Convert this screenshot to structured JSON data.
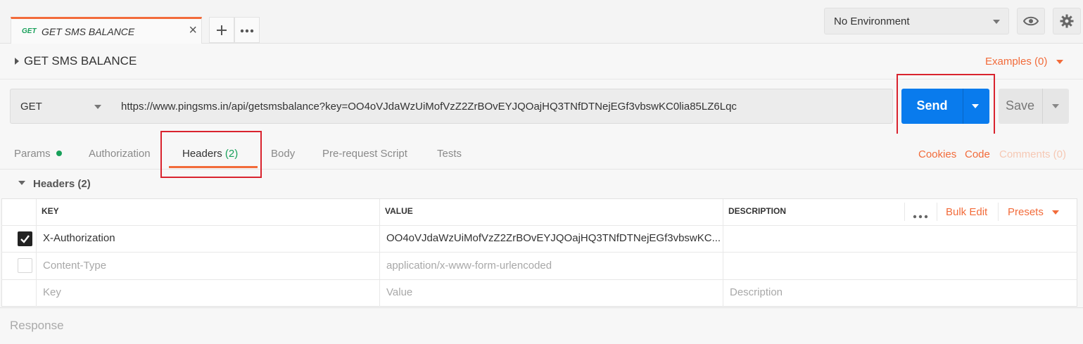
{
  "tab": {
    "method": "GET",
    "name": "GET SMS BALANCE"
  },
  "environment": {
    "selected": "No Environment"
  },
  "request": {
    "title": "GET SMS BALANCE",
    "examples": "Examples (0)",
    "method": "GET",
    "url": "https://www.pingsms.in/api/getsmsbalance?key=OO4oVJdaWzUiMofVzZ2ZrBOvEYJQOajHQ3TNfDTNejEGf3vbswKC0lia85LZ6Lqc",
    "send_label": "Send",
    "save_label": "Save"
  },
  "subtabs": {
    "params": "Params",
    "authorization": "Authorization",
    "headers": "Headers",
    "headers_count": "(2)",
    "body": "Body",
    "prerequest": "Pre-request Script",
    "tests": "Tests"
  },
  "links": {
    "cookies": "Cookies",
    "code": "Code",
    "comments": "Comments (0)"
  },
  "headers_section": {
    "title": "Headers",
    "count": "(2)",
    "columns": {
      "key": "KEY",
      "value": "VALUE",
      "description": "DESCRIPTION"
    },
    "bulk_edit": "Bulk Edit",
    "presets": "Presets",
    "rows": [
      {
        "checked": true,
        "key": "X-Authorization",
        "value": "OO4oVJdaWzUiMofVzZ2ZrBOvEYJQOajHQ3TNfDTNejEGf3vbswKC...",
        "description": ""
      },
      {
        "checked": false,
        "key": "Content-Type",
        "value": "application/x-www-form-urlencoded",
        "description": ""
      }
    ],
    "placeholders": {
      "key": "Key",
      "value": "Value",
      "description": "Description"
    }
  },
  "response": {
    "label": "Response"
  },
  "colors": {
    "accent": "#f26b3a",
    "send": "#097bed",
    "green": "#18a05a",
    "highlight": "#d9232e"
  }
}
